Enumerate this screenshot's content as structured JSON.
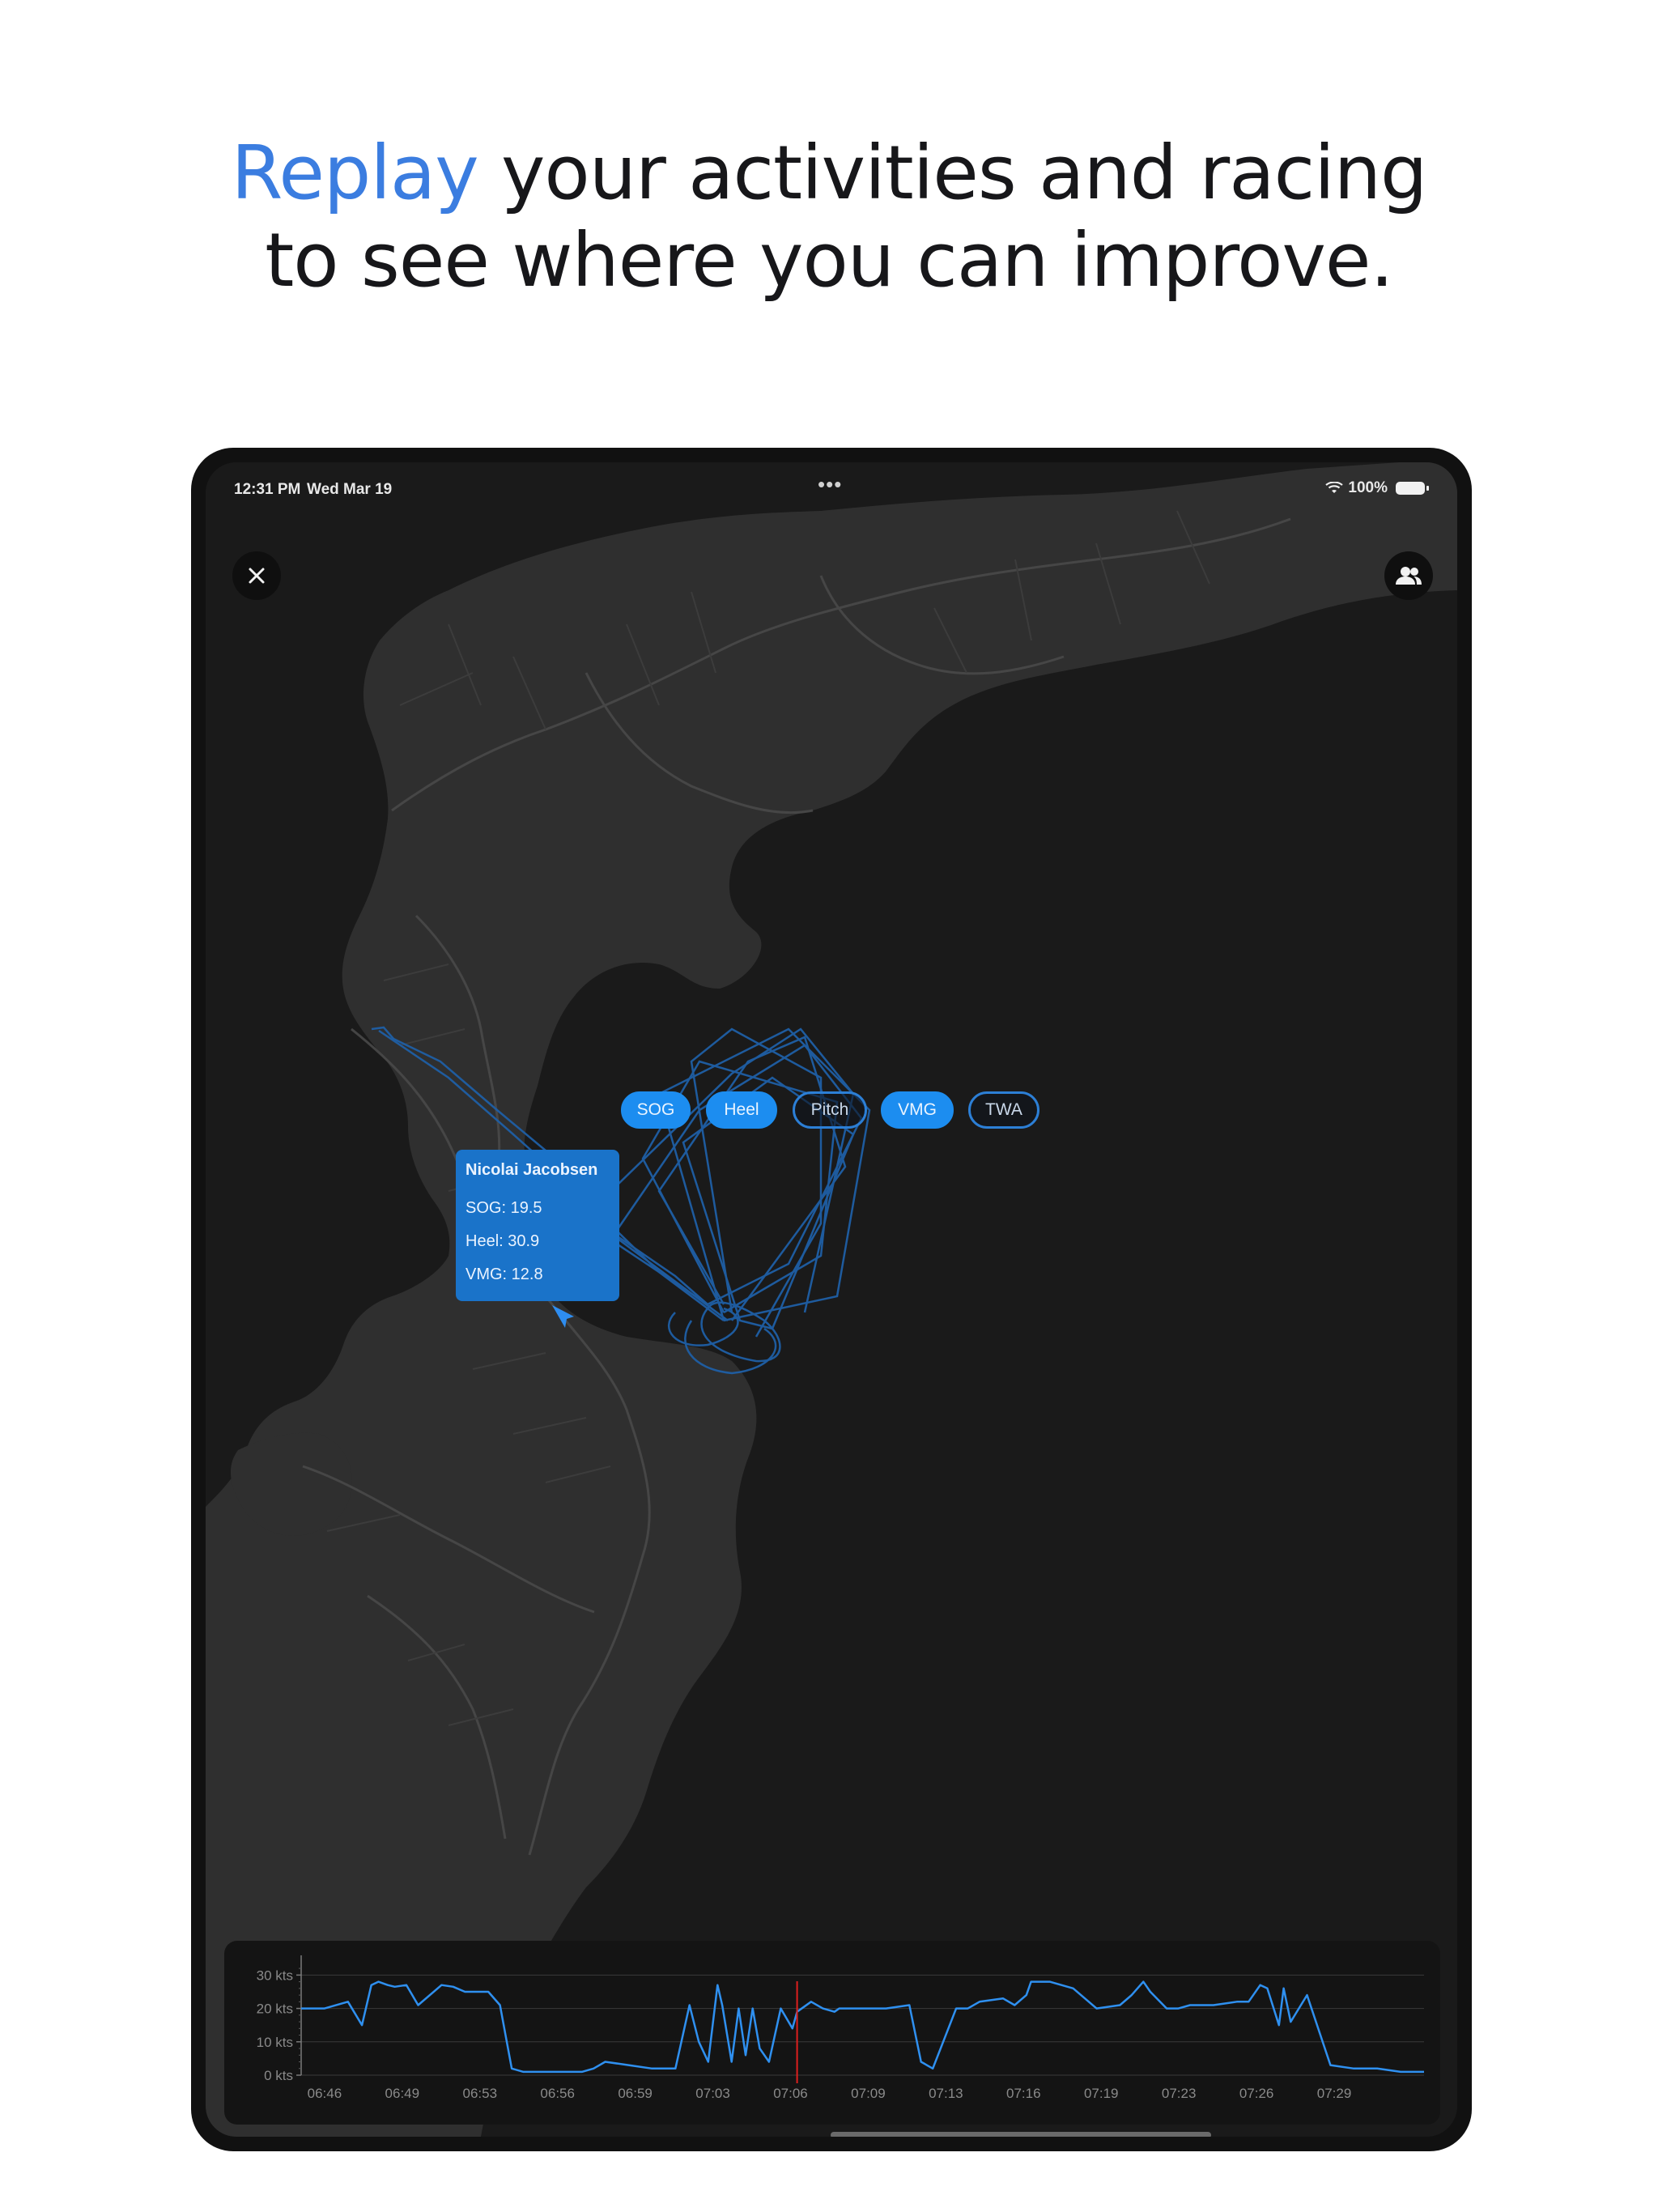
{
  "headline": {
    "accent": "Replay",
    "line1_rest": " your activities and racing",
    "line2": "to see where you can improve."
  },
  "status_bar": {
    "time": "12:31 PM",
    "date": "Wed Mar 19",
    "dots": "•••",
    "battery": "100%"
  },
  "metric_pills": [
    {
      "label": "SOG",
      "selected": true
    },
    {
      "label": "Heel",
      "selected": true
    },
    {
      "label": "Pitch",
      "selected": false
    },
    {
      "label": "VMG",
      "selected": true
    },
    {
      "label": "TWA",
      "selected": false
    }
  ],
  "athlete_card": {
    "name": "Nicolai Jacobsen",
    "sog": "SOG: 19.5",
    "heel": "Heel: 30.9",
    "vmg": "VMG: 12.8"
  },
  "colors": {
    "accent_blue": "#1c8df0",
    "track_blue": "#1f5fa6",
    "map_land": "#2f2f2f",
    "map_water": "#1a1a1a",
    "playhead": "#e0201e"
  },
  "icons": {
    "close": "close-icon",
    "people": "people-icon",
    "wifi": "wifi-icon",
    "battery": "battery-icon",
    "boat": "boat-arrow-icon"
  },
  "chart_data": {
    "type": "line",
    "title": "",
    "xlabel": "",
    "ylabel": "",
    "yticks": [
      "30 kts",
      "20 kts",
      "10 kts",
      "0 kts"
    ],
    "xticks": [
      "06:46",
      "06:49",
      "06:53",
      "06:56",
      "06:59",
      "07:03",
      "07:06",
      "07:09",
      "07:13",
      "07:16",
      "07:19",
      "07:23",
      "07:26",
      "07:29"
    ],
    "ylim": [
      0,
      33
    ],
    "xlim_minutes": [
      0,
      48
    ],
    "grid": true,
    "playhead_minute": 21.2,
    "series": [
      {
        "x": [
          0,
          1,
          2,
          2.6,
          3,
          3.3,
          3.7,
          4,
          4.5,
          5,
          6,
          6.5,
          7,
          8,
          8.5,
          9,
          9.5,
          10,
          11,
          12,
          12.5,
          13,
          14,
          15,
          16,
          16.6,
          17,
          17.4,
          17.8,
          18,
          18.4,
          18.7,
          19,
          19.3,
          19.6,
          20,
          20.5,
          21,
          21.2,
          21.8,
          22.3,
          22.8,
          23,
          24,
          25,
          26,
          26.5,
          27,
          28,
          28.5,
          29,
          30,
          30.5,
          31,
          31.2,
          32,
          33,
          34,
          35,
          35.5,
          36,
          36.3,
          37,
          37.5,
          38,
          39,
          40,
          40.5,
          41,
          41.3,
          41.8,
          42,
          42.3,
          43,
          44,
          45,
          46,
          47,
          48
        ],
        "y": [
          20,
          20,
          22,
          15,
          27,
          28,
          27,
          26.5,
          27,
          21,
          27,
          26.5,
          25,
          25,
          21,
          2,
          1,
          1,
          1,
          1,
          2,
          4,
          3,
          2,
          2,
          21,
          10,
          4,
          27,
          21,
          4,
          20,
          6,
          20,
          8,
          4,
          20,
          14,
          19,
          22,
          20,
          19,
          20,
          20,
          20,
          21,
          4,
          2,
          20,
          20,
          22,
          23,
          21,
          24,
          28,
          28,
          26,
          20,
          21,
          24,
          28,
          25,
          20,
          20,
          21,
          21,
          22,
          22,
          27,
          26,
          15,
          26,
          16,
          24,
          3,
          2,
          2,
          1,
          1
        ]
      }
    ]
  }
}
